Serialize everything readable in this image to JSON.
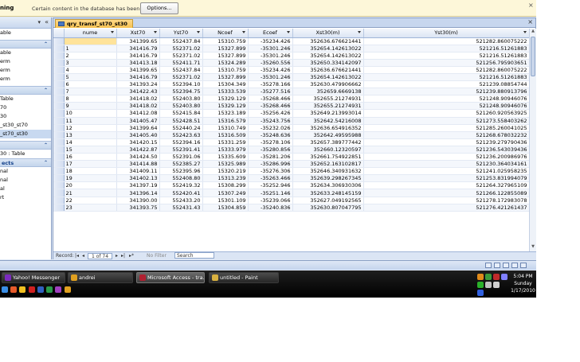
{
  "message_bar": {
    "warning": "ning",
    "text": "Certain content in the database has been disabled",
    "options_button": "Options...",
    "close": "×"
  },
  "nav": {
    "dropdown_glyph": "▾",
    "collapse_glyph": "«",
    "groups": [
      {
        "items": [
          "able"
        ],
        "chev": "⌃"
      },
      {
        "items": [
          "able",
          "erm",
          "erm",
          "erm"
        ],
        "chev": "⌃"
      },
      {
        "items": [
          "Table",
          "70",
          "30",
          "_st30_st70",
          "_st70_st30"
        ],
        "chev": "⌃"
      },
      {
        "items": [
          "30 : Table"
        ],
        "chev": "⌃"
      },
      {
        "header": "ects",
        "items": [
          "nal",
          "nal",
          "al",
          "rt"
        ],
        "chev": "⌃"
      }
    ],
    "selected_item": "_st70_st30"
  },
  "document": {
    "tab_title": "qry_transf_st70_st30",
    "close": "×",
    "columns": [
      "nume",
      "Xst70",
      "Yst70",
      "Ncoef",
      "Ecoef",
      "Xst30(m)",
      "Yst30(m)"
    ],
    "rows": [
      [
        "",
        "341399.65",
        "552437.84",
        "15310.759",
        "-35234.426",
        "352636.676621441",
        "521282.860075222"
      ],
      [
        "1",
        "341416.79",
        "552371.02",
        "15327.899",
        "-35301.246",
        "352654.142613022",
        "521216.51261883"
      ],
      [
        "2",
        "341416.79",
        "552371.02",
        "15327.899",
        "-35301.246",
        "352654.142613022",
        "521216.51261883"
      ],
      [
        "3",
        "341413.18",
        "552411.71",
        "15324.289",
        "-35260.556",
        "352650.334142097",
        "521256.795903651"
      ],
      [
        "4",
        "341399.65",
        "552437.84",
        "15310.759",
        "-35234.426",
        "352636.676621441",
        "521282.860075222"
      ],
      [
        "5",
        "341416.79",
        "552371.02",
        "15327.899",
        "-35301.246",
        "352654.142613022",
        "521216.51261883"
      ],
      [
        "6",
        "341393.24",
        "552394.10",
        "15304.349",
        "-35278.166",
        "352630.479906662",
        "521239.08854744"
      ],
      [
        "7",
        "341422.43",
        "552394.75",
        "15333.539",
        "-35277.516",
        "352659.6669138",
        "521239.880913796"
      ],
      [
        "8",
        "341418.02",
        "552403.80",
        "15329.129",
        "-35268.466",
        "352655.21274931",
        "521248.90946076"
      ],
      [
        "9",
        "341418.02",
        "552403.80",
        "15329.129",
        "-35268.466",
        "352655.21274931",
        "521248.90946076"
      ],
      [
        "10",
        "341412.08",
        "552415.84",
        "15323.189",
        "-35256.426",
        "352649.213993014",
        "521260.920563925"
      ],
      [
        "11",
        "341405.47",
        "552428.51",
        "15316.579",
        "-35243.756",
        "352642.54216008",
        "521273.558403262"
      ],
      [
        "12",
        "341399.64",
        "552440.24",
        "15310.749",
        "-35232.026",
        "352636.654916352",
        "521285.260041025"
      ],
      [
        "13",
        "341405.40",
        "552423.63",
        "15316.509",
        "-35248.636",
        "352642.49595988",
        "521268.678032232"
      ],
      [
        "14",
        "341420.15",
        "552394.16",
        "15331.259",
        "-35278.106",
        "352657.389777442",
        "521239.279790436"
      ],
      [
        "15",
        "341422.87",
        "552391.41",
        "15333.979",
        "-35280.856",
        "352660.12320597",
        "521236.543039436"
      ],
      [
        "16",
        "341424.50",
        "552391.06",
        "15335.609",
        "-35281.206",
        "352661.754922851",
        "521236.200986976"
      ],
      [
        "17",
        "341414.88",
        "552385.27",
        "15325.989",
        "-35286.996",
        "352652.163102817",
        "521230.364034161"
      ],
      [
        "18",
        "341409.11",
        "552395.96",
        "15320.219",
        "-35276.306",
        "352646.340931632",
        "521241.025958235"
      ],
      [
        "19",
        "341402.13",
        "552408.80",
        "15313.239",
        "-35263.466",
        "352639.298267345",
        "521253.831994079"
      ],
      [
        "20",
        "341397.19",
        "552419.32",
        "15308.299",
        "-35252.946",
        "352634.306930306",
        "521264.327965109"
      ],
      [
        "21",
        "341396.14",
        "552420.41",
        "15307.249",
        "-35251.146",
        "352633.248145159",
        "521266.122855089"
      ],
      [
        "22",
        "341390.00",
        "552433.20",
        "15301.109",
        "-35239.066",
        "352627.049192565",
        "521278.172983078"
      ],
      [
        "23",
        "341393.75",
        "552431.43",
        "15304.859",
        "-35240.836",
        "352630.807047795",
        "521276.421261437"
      ]
    ]
  },
  "record_nav": {
    "label": "Record:",
    "first": "|◂",
    "prev": "◂",
    "current": "1 of 74",
    "next": "▸",
    "last": "▸|",
    "new": "▸*",
    "filter": "No Filter",
    "search": "Search"
  },
  "taskbar": {
    "tasks": [
      {
        "label": "Yahoo! Messenger",
        "color": "#7b2bbf"
      },
      {
        "label": "andrei",
        "color": "#e0a020"
      },
      {
        "label": "Microsoft Access - tra...",
        "color": "#b02030"
      },
      {
        "label": "untitled - Paint",
        "color": "#d8b040"
      }
    ],
    "clock": {
      "time": "5:04 PM",
      "day": "Sunday",
      "date": "1/17/2010"
    }
  }
}
